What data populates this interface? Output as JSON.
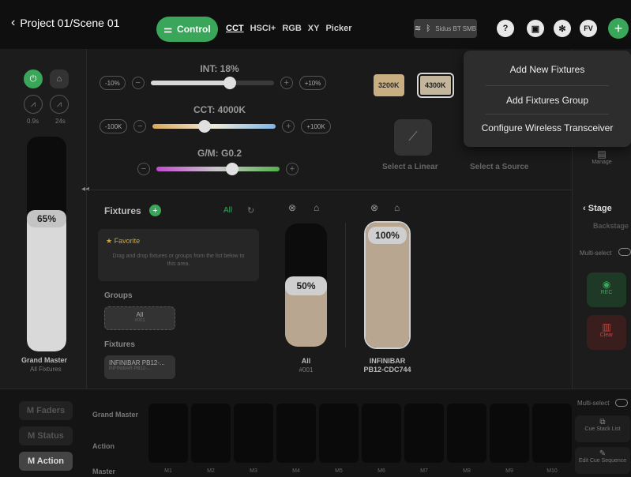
{
  "header": {
    "title": "Project 01/Scene 01",
    "control_label": "Control",
    "modes": [
      "CCT",
      "HSCI+",
      "RGB",
      "XY",
      "Picker"
    ],
    "connection_text": "Sidus BT SMB",
    "avatar_initials": "FV",
    "help_label": "?"
  },
  "dropdown": {
    "items": [
      "Add New Fixtures",
      "Add Fixtures Group",
      "Configure Wireless Transceiver"
    ]
  },
  "left": {
    "fade_in": "0.9s",
    "fade_out": "24s",
    "gm_percent": "65%",
    "gm_value": 0.65,
    "gm_label": "Grand Master",
    "gm_sub": "All Fixtures"
  },
  "controls": {
    "int_title": "INT: 18%",
    "int_value": 0.18,
    "minus10": "-10%",
    "plus10": "+10%",
    "cct_title": "CCT: 4000K",
    "minus100": "-100K",
    "plus100": "+100K",
    "gm_title": "G/M: G0.2",
    "presets": [
      "3200K",
      "4300K"
    ],
    "select_linear": "Select a Linear",
    "select_source": "Select a Source"
  },
  "fixtures_panel": {
    "title": "Fixtures",
    "filter_all": "All",
    "favorite": "★ Favorite",
    "drop_hint": "Drag and drop fixtures or groups from the list below to this area.",
    "groups_title": "Groups",
    "group_name": "All",
    "group_id": "#001",
    "fixtures_title": "Fixtures",
    "fixture_name": "INFINIBAR PB12-...",
    "fixture_sub": "INFINIBAR PB12-..."
  },
  "faders": [
    {
      "percent": "50%",
      "value": 0.5,
      "label": "All",
      "sub": "#001"
    },
    {
      "percent": "100%",
      "value": 1.0,
      "label": "INFINIBAR",
      "sub": "PB12-CDC744"
    }
  ],
  "right": {
    "manage": "Manage",
    "stage": "Stage",
    "backstage": "Backstage",
    "multiselect": "Multi-select",
    "rec": "REC",
    "clear": "Clear"
  },
  "bottom": {
    "tabs": [
      "M Faders",
      "M Status",
      "M Action"
    ],
    "row_labels": [
      "Grand Master",
      "Action",
      "Master"
    ],
    "slots": [
      "M1",
      "M2",
      "M3",
      "M4",
      "M5",
      "M6",
      "M7",
      "M8",
      "M9",
      "M10"
    ],
    "multiselect": "Multi-select",
    "cue_stack": "Cue Stack List",
    "edit_cue": "Edit Cue Sequence"
  },
  "colors": {
    "accent": "#3aa65a",
    "fader_fill": "#b9a690",
    "preset_warm": "#c9ae82",
    "rec": "#2f8f4a",
    "clear": "#b53a3a"
  }
}
